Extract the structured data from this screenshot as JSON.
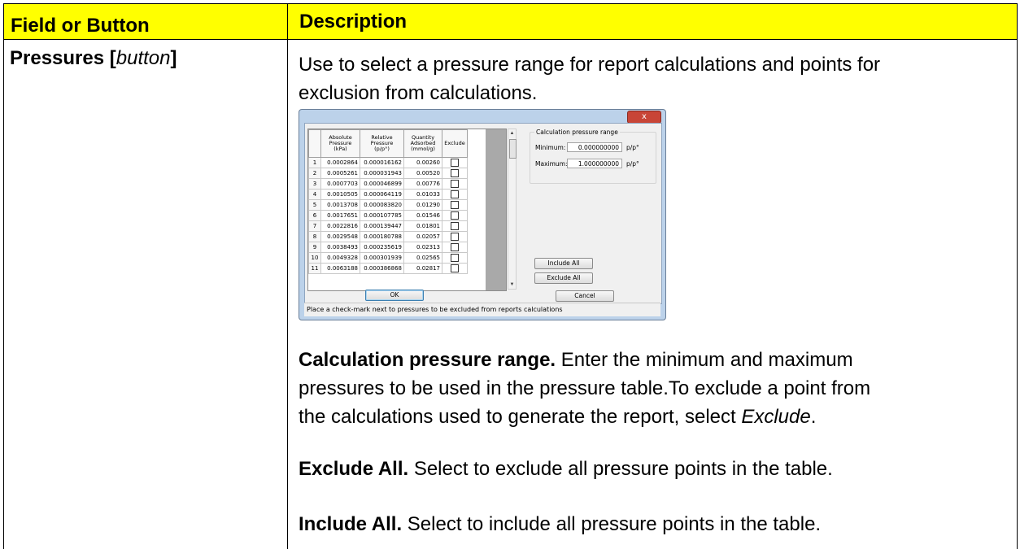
{
  "table": {
    "header_col1": "Field or Button",
    "header_col2": "Description",
    "colors": {
      "header_bg": "#ffff00",
      "border": "#000000"
    }
  },
  "row": {
    "field_bold": "Pressures [",
    "field_italic": "button",
    "field_close": "]",
    "intro_line1": "Use to select a pressure range for report calculations and points for",
    "intro_line2": "exclusion from calculations.",
    "para1_bold": "Calculation pressure range.",
    "para1_l1": " Enter the minimum and maximum",
    "para1_l2": "pressures to be used in the pressure table.To exclude a point from",
    "para1_l3a": "the calculations used to generate the report, select ",
    "para1_l3_italic": "Exclude",
    "para1_l3b": ".",
    "para2_bold": "Exclude All.",
    "para2_text": " Select to exclude all pressure points in the table.",
    "para3_bold": "Include All.",
    "para3_text": " Select to include all pressure points in the table."
  },
  "dialog": {
    "close_glyph": "x",
    "columns": [
      "Absolute\nPressure\n(kPa)",
      "Relative\nPressure\n(p/p°)",
      "Quantity\nAdsorbed\n(mmol/g)",
      "Exclude"
    ],
    "rows": [
      [
        "1",
        "0.0002864",
        "0.000016162",
        "0.00260"
      ],
      [
        "2",
        "0.0005261",
        "0.000031943",
        "0.00520"
      ],
      [
        "3",
        "0.0007703",
        "0.000046899",
        "0.00776"
      ],
      [
        "4",
        "0.0010505",
        "0.000064119",
        "0.01033"
      ],
      [
        "5",
        "0.0013708",
        "0.000083820",
        "0.01290"
      ],
      [
        "6",
        "0.0017651",
        "0.000107785",
        "0.01546"
      ],
      [
        "7",
        "0.0022816",
        "0.000139447",
        "0.01801"
      ],
      [
        "8",
        "0.0029548",
        "0.000180788",
        "0.02057"
      ],
      [
        "9",
        "0.0038493",
        "0.000235619",
        "0.02313"
      ],
      [
        "10",
        "0.0049328",
        "0.000301939",
        "0.02565"
      ],
      [
        "11",
        "0.0063188",
        "0.000386868",
        "0.02817"
      ]
    ],
    "range_title": "Calculation pressure range",
    "min_label": "Minimum:",
    "min_value": "0.000000000",
    "max_label": "Maximum:",
    "max_value": "1.000000000",
    "unit": "p/p°",
    "include_all": "Include All",
    "exclude_all": "Exclude All",
    "ok": "OK",
    "cancel": "Cancel",
    "status": "Place a check-mark next to pressures to be excluded from reports calculations"
  }
}
